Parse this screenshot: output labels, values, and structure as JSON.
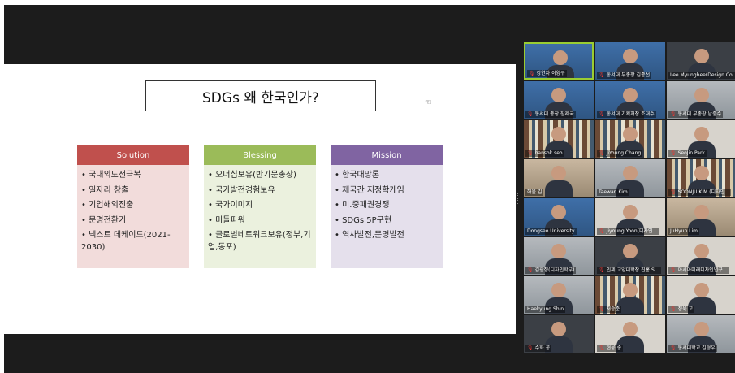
{
  "slide": {
    "title": "SDGs 왜 한국인가?",
    "columns": [
      {
        "header": "Solution",
        "items": [
          "국내외도전극복",
          "일자리 창출",
          "기업해외진출",
          "문명전환기",
          "넥스트 데케이드(2021-2030)"
        ]
      },
      {
        "header": "Blessing",
        "items": [
          "오너십보유(반기문총장)",
          "국가발전경험보유",
          "국가이미지",
          "미들파워",
          "글로벌네트워크보유(정부,기업,동포)"
        ]
      },
      {
        "header": "Mission",
        "items": [
          "한국대망론",
          "제국간 지정학게임",
          "미.중패권경쟁",
          "SDGs 5P구현",
          "역사발전,문명발전"
        ]
      }
    ]
  },
  "participants": [
    {
      "name": "강연자 이양구",
      "bg": "world",
      "muted": true,
      "active": true
    },
    {
      "name": "동서대 부총장 김종선",
      "bg": "world",
      "muted": true
    },
    {
      "name": "Lee Myunghee(Design Co...",
      "bg": "dark",
      "muted": false
    },
    {
      "name": "동서대 총장 장제국",
      "bg": "world",
      "muted": true
    },
    {
      "name": "동서대 기획처장 조대수",
      "bg": "world",
      "muted": true
    },
    {
      "name": "동서대 부총장 남중수",
      "bg": "office",
      "muted": true
    },
    {
      "name": "hansok seo",
      "bg": "shelf",
      "muted": true
    },
    {
      "name": "JiYoung Chang",
      "bg": "shelf",
      "muted": true
    },
    {
      "name": "SeoJin Park",
      "bg": "wall",
      "muted": true
    },
    {
      "name": "해윤 김",
      "bg": "warm",
      "muted": false
    },
    {
      "name": "Taewan Kim",
      "bg": "office",
      "muted": false
    },
    {
      "name": "SOONJU KIM (디자인...",
      "bg": "shelf",
      "muted": true
    },
    {
      "name": "Dongseo University",
      "bg": "world",
      "muted": false
    },
    {
      "name": "Jiyoung Yoon(디자인...",
      "bg": "wall",
      "muted": true
    },
    {
      "name": "JuHyun Lim",
      "bg": "warm",
      "muted": false
    },
    {
      "name": "김광정(디자인학부)",
      "bg": "office",
      "muted": true
    },
    {
      "name": "인제 고양대학장 진홍 S...",
      "bg": "dark",
      "muted": true
    },
    {
      "name": "아시아미래디자인연구...",
      "bg": "wall",
      "muted": true
    },
    {
      "name": "Haekyung Shin",
      "bg": "office",
      "muted": false
    },
    {
      "name": "처승준",
      "bg": "shelf",
      "muted": true
    },
    {
      "name": "정욱 고",
      "bg": "wall",
      "muted": true
    },
    {
      "name": "수화 공",
      "bg": "dark",
      "muted": true
    },
    {
      "name": "현웅 송",
      "bg": "wall",
      "muted": true
    },
    {
      "name": "동서대학교 김형우",
      "bg": "office",
      "muted": true
    }
  ]
}
